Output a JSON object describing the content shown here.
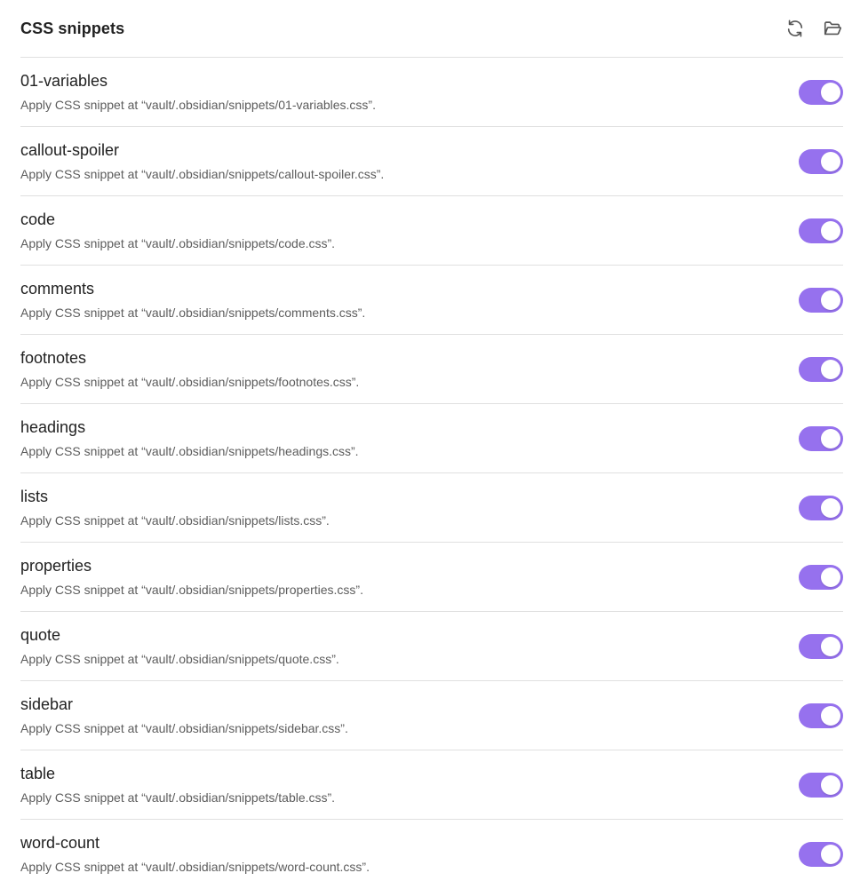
{
  "header": {
    "title": "CSS snippets",
    "reload_icon": "reload-icon",
    "folder_icon": "open-folder-icon"
  },
  "accent_color": "#9671ee",
  "snippets": [
    {
      "name": "01-variables",
      "desc": "Apply CSS snippet at “vault/.obsidian/snippets/01-variables.css”.",
      "enabled": true
    },
    {
      "name": "callout-spoiler",
      "desc": "Apply CSS snippet at “vault/.obsidian/snippets/callout-spoiler.css”.",
      "enabled": true
    },
    {
      "name": "code",
      "desc": "Apply CSS snippet at “vault/.obsidian/snippets/code.css”.",
      "enabled": true
    },
    {
      "name": "comments",
      "desc": "Apply CSS snippet at “vault/.obsidian/snippets/comments.css”.",
      "enabled": true
    },
    {
      "name": "footnotes",
      "desc": "Apply CSS snippet at “vault/.obsidian/snippets/footnotes.css”.",
      "enabled": true
    },
    {
      "name": "headings",
      "desc": "Apply CSS snippet at “vault/.obsidian/snippets/headings.css”.",
      "enabled": true
    },
    {
      "name": "lists",
      "desc": "Apply CSS snippet at “vault/.obsidian/snippets/lists.css”.",
      "enabled": true
    },
    {
      "name": "properties",
      "desc": "Apply CSS snippet at “vault/.obsidian/snippets/properties.css”.",
      "enabled": true
    },
    {
      "name": "quote",
      "desc": "Apply CSS snippet at “vault/.obsidian/snippets/quote.css”.",
      "enabled": true
    },
    {
      "name": "sidebar",
      "desc": "Apply CSS snippet at “vault/.obsidian/snippets/sidebar.css”.",
      "enabled": true
    },
    {
      "name": "table",
      "desc": "Apply CSS snippet at “vault/.obsidian/snippets/table.css”.",
      "enabled": true
    },
    {
      "name": "word-count",
      "desc": "Apply CSS snippet at “vault/.obsidian/snippets/word-count.css”.",
      "enabled": true
    }
  ]
}
